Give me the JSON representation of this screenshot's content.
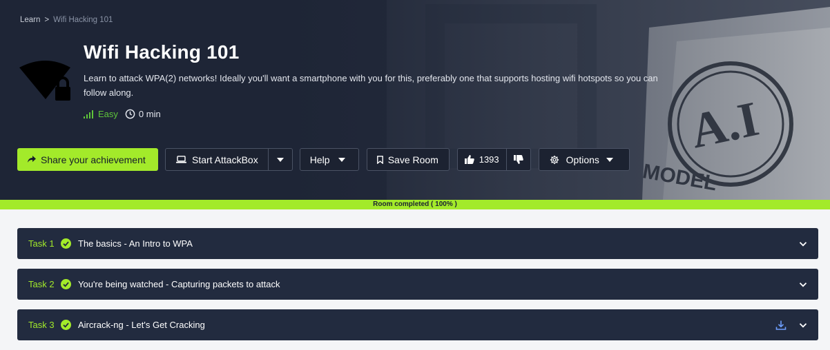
{
  "breadcrumb": {
    "root": "Learn",
    "separator": ">",
    "current": "Wifi Hacking 101"
  },
  "room": {
    "title": "Wifi Hacking 101",
    "description": "Learn to attack WPA(2) networks! Ideally you'll want a smartphone with you for this, preferably one that supports hosting wifi hotspots so you can follow along.",
    "difficulty": "Easy",
    "duration": "0 min",
    "icon": "wifi-lock-icon"
  },
  "actions": {
    "share_label": "Share your achievement",
    "attackbox_label": "Start AttackBox",
    "help_label": "Help",
    "save_label": "Save Room",
    "upvotes": "1393",
    "options_label": "Options"
  },
  "progress": {
    "label": "Room completed ( 100% )",
    "percent": 100
  },
  "tasks": [
    {
      "num": "Task 1",
      "title": "The basics - An Intro to WPA",
      "completed": true,
      "download": false
    },
    {
      "num": "Task 2",
      "title": "You're being watched - Capturing packets to attack",
      "completed": true,
      "download": false
    },
    {
      "num": "Task 3",
      "title": "Aircrack-ng - Let's Get Cracking",
      "completed": true,
      "download": true
    }
  ],
  "colors": {
    "accent": "#a3ea2a",
    "hero_bg": "#1e2536",
    "task_bg": "#222b3f",
    "easy": "#5fc53a"
  }
}
